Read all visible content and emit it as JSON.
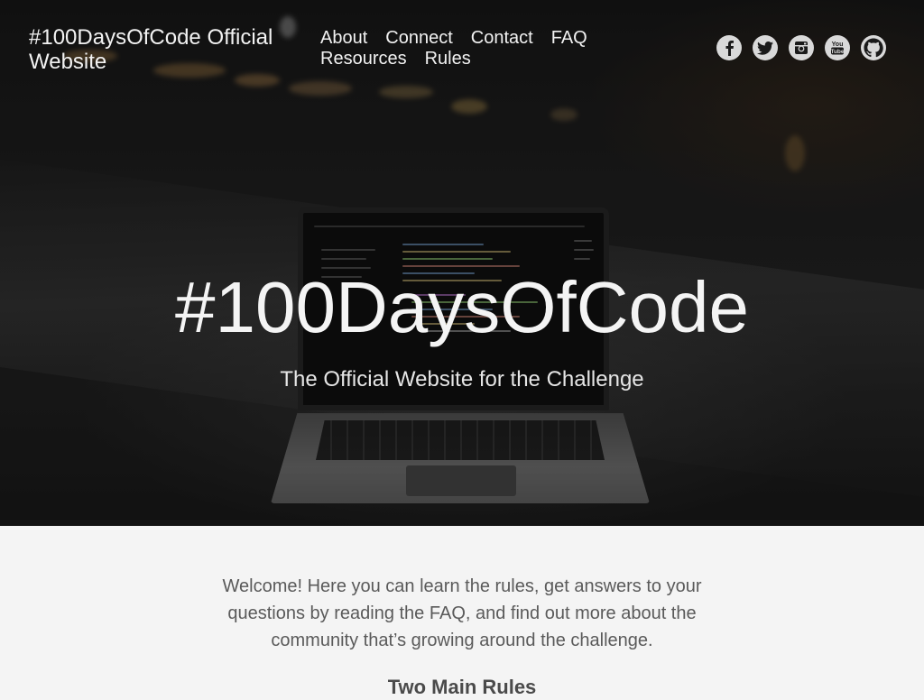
{
  "header": {
    "site_title": "#100DaysOfCode Official Website",
    "nav": [
      {
        "label": "About"
      },
      {
        "label": "Connect"
      },
      {
        "label": "Contact"
      },
      {
        "label": "FAQ"
      },
      {
        "label": "Resources"
      },
      {
        "label": "Rules"
      }
    ],
    "social": [
      {
        "icon": "facebook-icon"
      },
      {
        "icon": "twitter-icon"
      },
      {
        "icon": "instagram-icon"
      },
      {
        "icon": "youtube-icon"
      },
      {
        "icon": "github-icon"
      }
    ]
  },
  "hero": {
    "title": "#100DaysOfCode",
    "subtitle": "The Official Website for the Challenge"
  },
  "content": {
    "intro": "Welcome! Here you can learn the rules, get answers to your questions by reading the FAQ, and find out more about the community that’s growing around the challenge.",
    "rules_heading": "Two Main Rules"
  },
  "colors": {
    "hero_text": "#f4f4f4",
    "body_bg": "#f4f4f4",
    "body_text": "#5a5a5a",
    "icon_bg": "#d9d9d9",
    "icon_fg": "#1a1a1a"
  }
}
